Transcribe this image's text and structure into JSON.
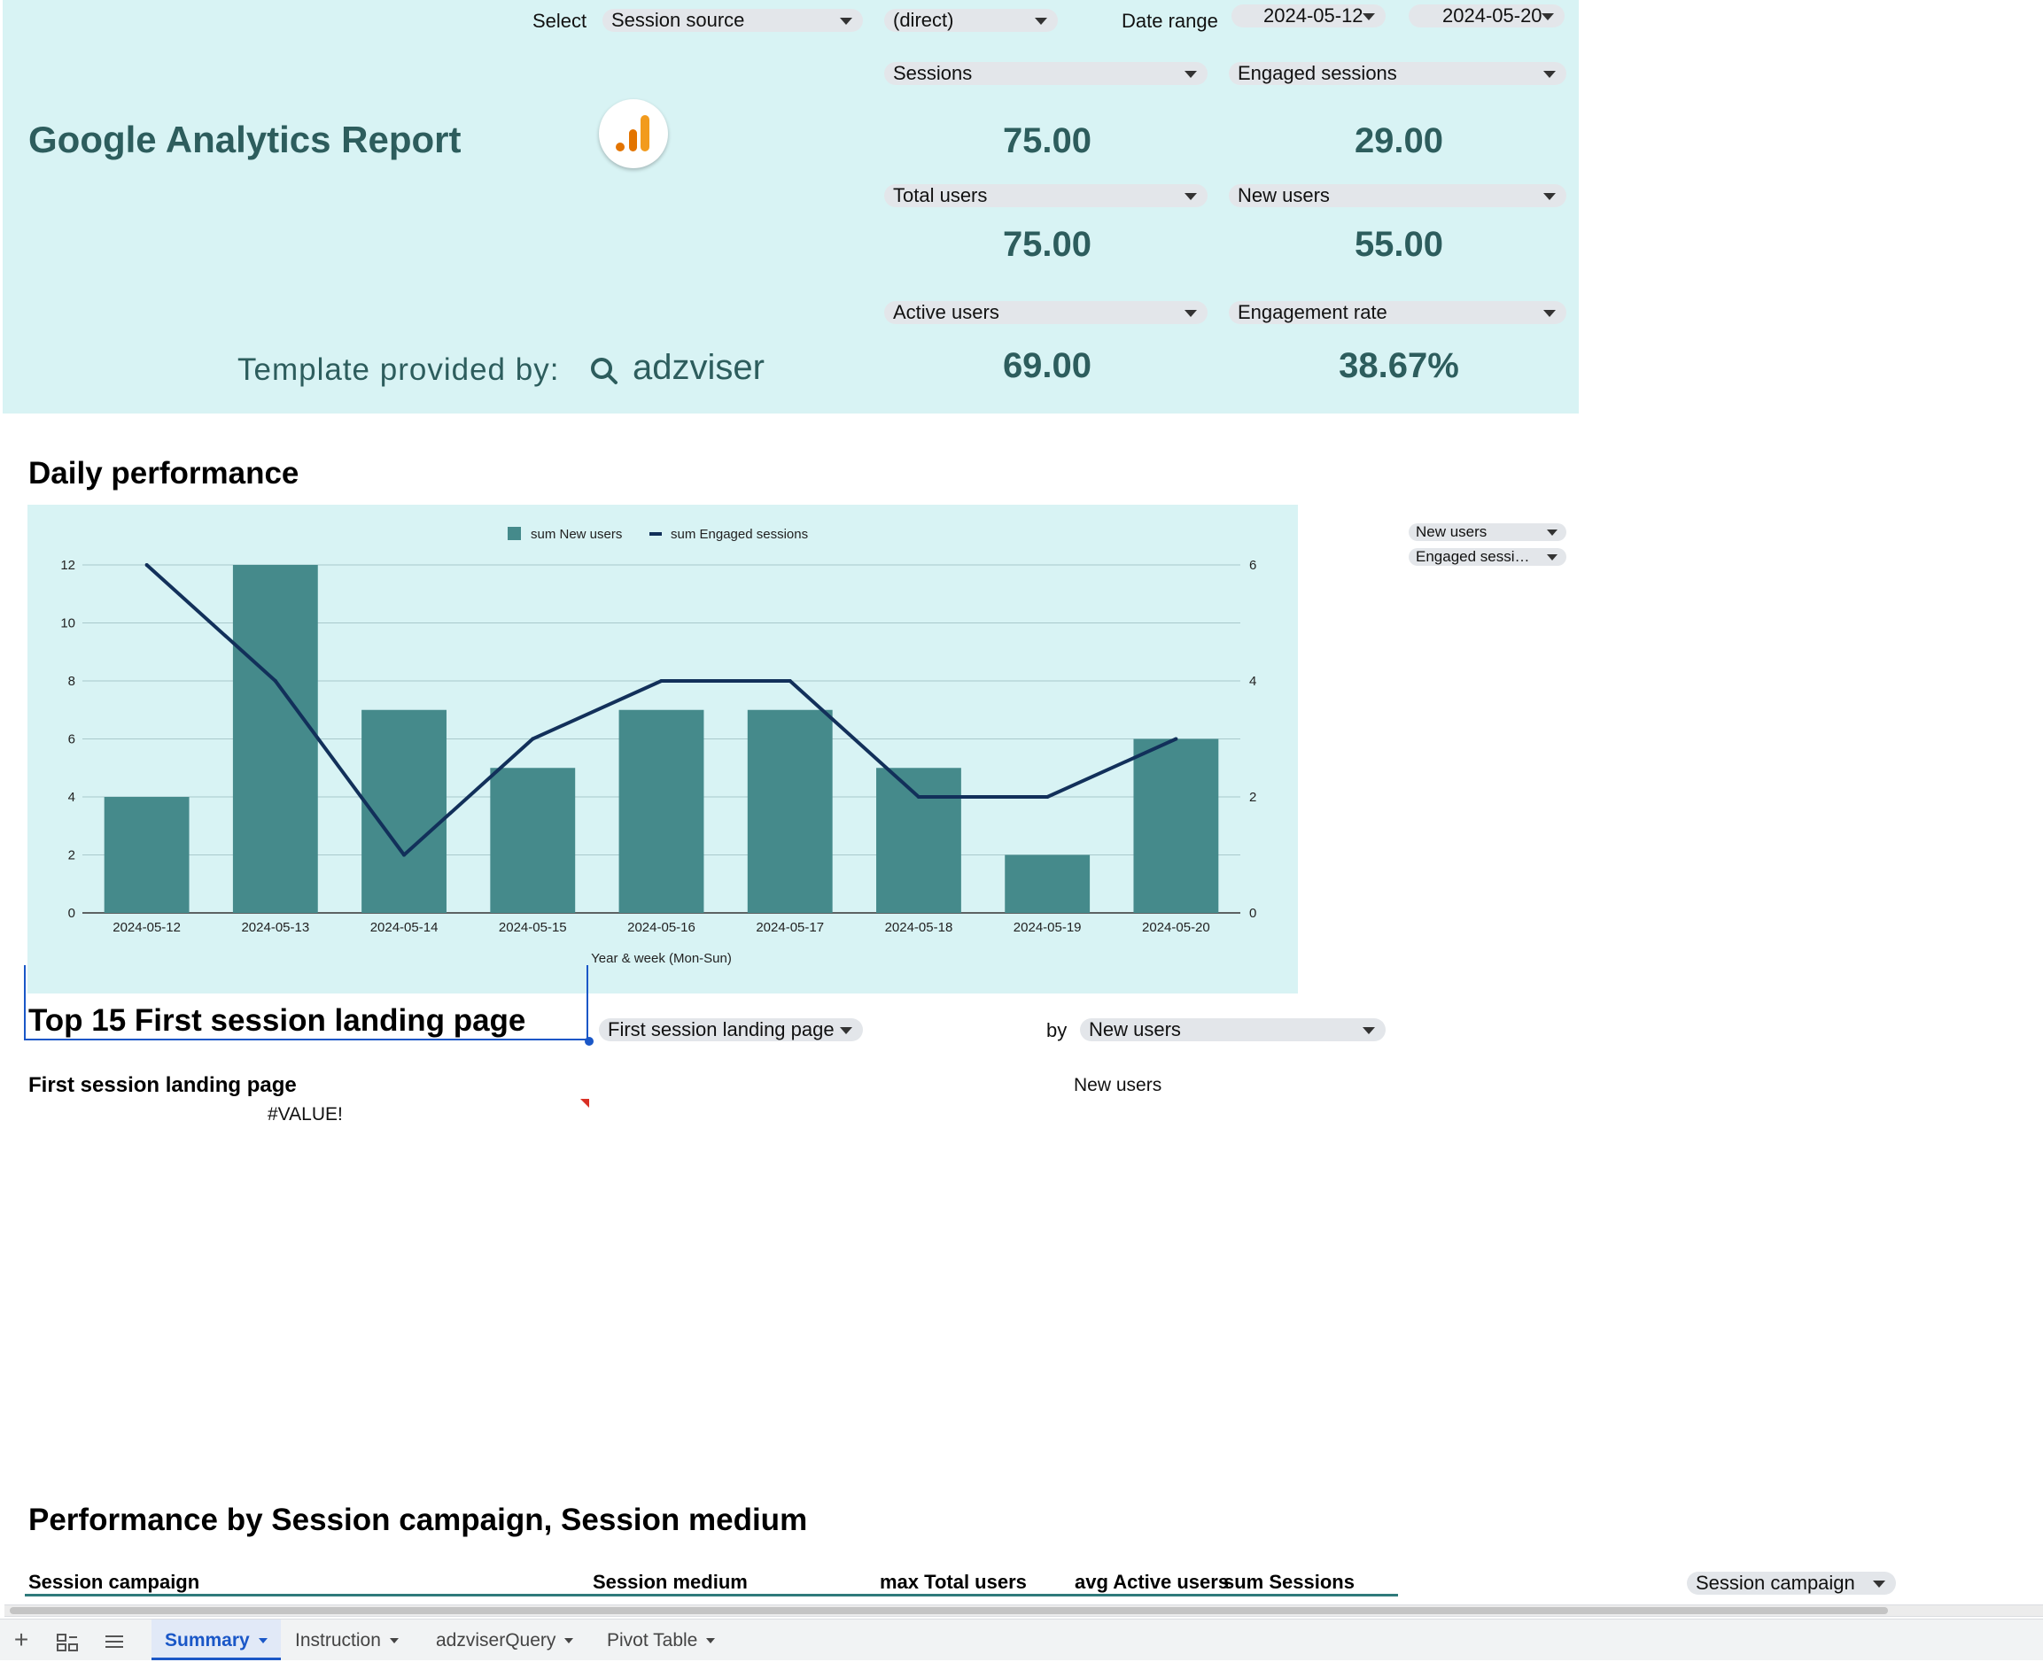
{
  "header": {
    "select_label": "Select",
    "source_dimension": "Session source",
    "source_value": "(direct)",
    "date_range_label": "Date range",
    "date_start": "2024-05-12",
    "date_end": "2024-05-20",
    "title": "Google Analytics Report",
    "template_credit": "Template provided by:",
    "brand": "adzviser"
  },
  "metrics": [
    {
      "selector": "Sessions",
      "value": "75.00"
    },
    {
      "selector": "Engaged sessions",
      "value": "29.00"
    },
    {
      "selector": "Total users",
      "value": "75.00"
    },
    {
      "selector": "New users",
      "value": "55.00"
    },
    {
      "selector": "Active users",
      "value": "69.00"
    },
    {
      "selector": "Engagement rate",
      "value": "38.67%"
    }
  ],
  "daily": {
    "title": "Daily performance",
    "metric_selectors": [
      "New users",
      "Engaged sessi…"
    ]
  },
  "chart_data": {
    "type": "bar",
    "categories": [
      "2024-05-12",
      "2024-05-13",
      "2024-05-14",
      "2024-05-15",
      "2024-05-16",
      "2024-05-17",
      "2024-05-18",
      "2024-05-19",
      "2024-05-20"
    ],
    "series": [
      {
        "name": "sum New users",
        "type": "bar",
        "axis": "left",
        "color": "#458a8b",
        "values": [
          4,
          12,
          7,
          5,
          7,
          7,
          5,
          2,
          6
        ]
      },
      {
        "name": "sum Engaged sessions",
        "type": "line",
        "axis": "right",
        "color": "#12305a",
        "values": [
          6,
          4,
          1,
          3,
          4,
          4,
          2,
          2,
          3
        ]
      }
    ],
    "xlabel": "Year & week (Mon-Sun)",
    "ylim_left": [
      0,
      12
    ],
    "yticks_left": [
      "0",
      "2",
      "4",
      "6",
      "8",
      "10",
      "12"
    ],
    "ylim_right": [
      0,
      6
    ],
    "yticks_right": [
      "0",
      "2",
      "4",
      "6"
    ],
    "legend": "top",
    "grid": true
  },
  "landing": {
    "title": "Top 15 First session landing page",
    "dimension_selector": "First session landing page",
    "by_label": "by",
    "metric_selector": "New users",
    "col_dimension": "First session landing page",
    "col_metric": "New users",
    "error_value": "#VALUE!"
  },
  "campaign": {
    "title": "Performance by Session campaign, Session medium",
    "columns": [
      "Session campaign",
      "Session medium",
      "max Total users",
      "avg Active users",
      "sum Sessions"
    ],
    "selector": "Session campaign"
  },
  "tabs": [
    {
      "label": "Summary",
      "active": true
    },
    {
      "label": "Instruction",
      "active": false
    },
    {
      "label": "adzviserQuery",
      "active": false
    },
    {
      "label": "Pivot Table",
      "active": false
    }
  ],
  "colors": {
    "panel_bg": "#d8f3f4",
    "metric_text": "#2d5d5d",
    "bar": "#458a8b",
    "line": "#12305a",
    "ga_orange": "#f29b1d",
    "ga_dark_orange": "#e37400"
  },
  "icons": [
    "add-sheet-icon",
    "all-sheets-icon",
    "sheet-list-icon",
    "google-analytics-logo",
    "search-icon"
  ]
}
